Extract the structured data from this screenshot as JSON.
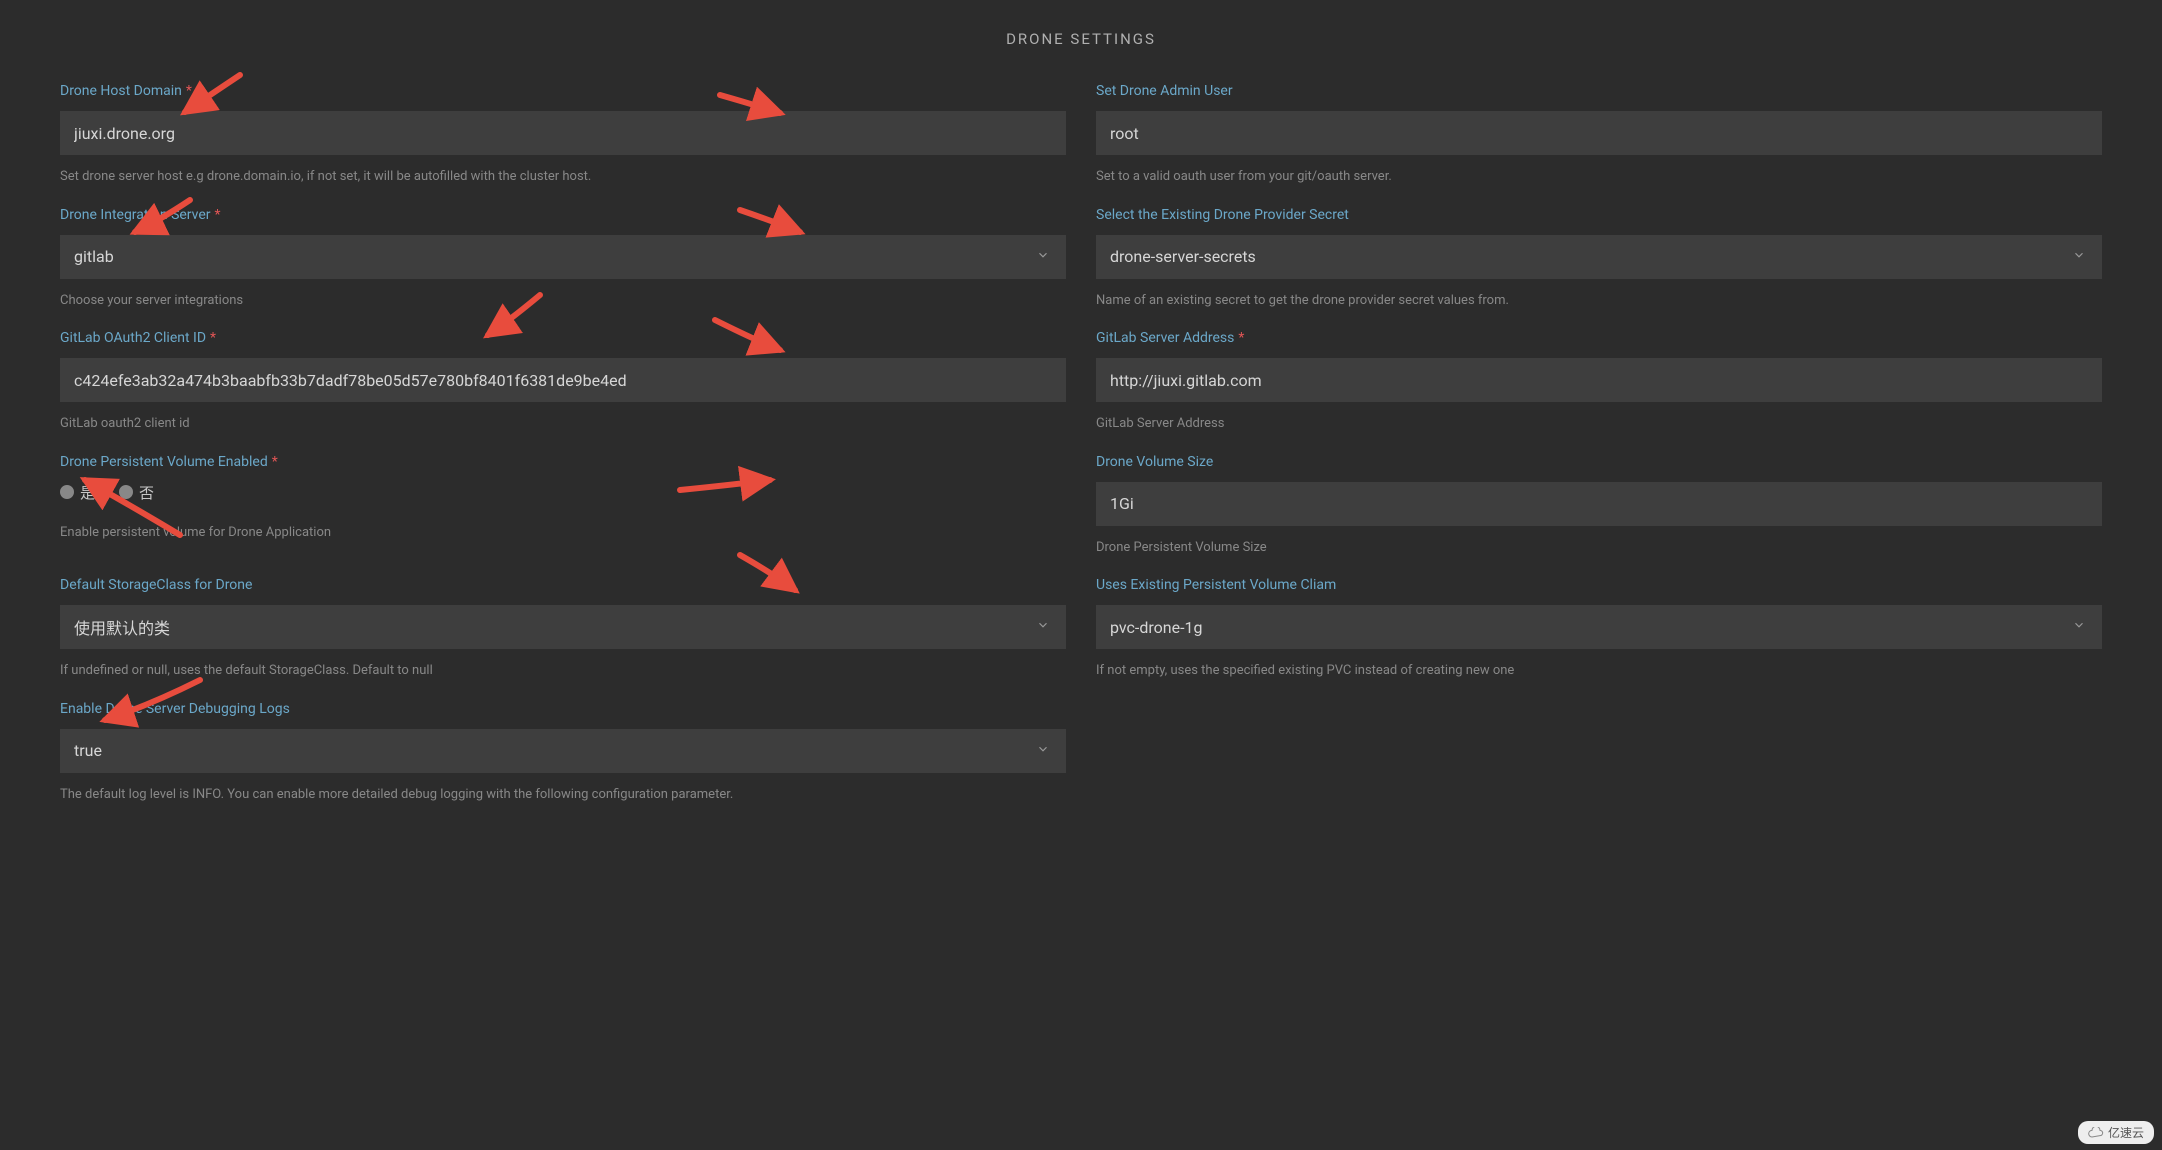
{
  "section": {
    "title": "DRONE SETTINGS"
  },
  "fields": {
    "hostDomain": {
      "label": "Drone Host Domain",
      "value": "jiuxi.drone.org",
      "help": "Set drone server host e.g drone.domain.io, if not set, it will be autofilled with the cluster host."
    },
    "adminUser": {
      "label": "Set Drone Admin User",
      "value": "root",
      "help": "Set to a valid oauth user from your git/oauth server."
    },
    "integrationServer": {
      "label": "Drone Integration Server",
      "value": "gitlab",
      "help": "Choose your server integrations"
    },
    "providerSecret": {
      "label": "Select the Existing Drone Provider Secret",
      "value": "drone-server-secrets",
      "help": "Name of an existing secret to get the drone provider secret values from."
    },
    "oauthClientId": {
      "label": "GitLab OAuth2 Client ID",
      "value": "c424efe3ab32a474b3baabfb33b7dadf78be05d57e780bf8401f6381de9be4ed",
      "help": "GitLab oauth2 client id"
    },
    "serverAddress": {
      "label": "GitLab Server Address",
      "value": "http://jiuxi.gitlab.com",
      "help": "GitLab Server Address"
    },
    "pvEnabled": {
      "label": "Drone Persistent Volume Enabled",
      "yes": "是",
      "no": "否",
      "help": "Enable persistent volume for Drone Application"
    },
    "volumeSize": {
      "label": "Drone Volume Size",
      "value": "1Gi",
      "help": "Drone Persistent Volume Size"
    },
    "storageClass": {
      "label": "Default StorageClass for Drone",
      "value": "使用默认的类",
      "help": "If undefined or null, uses the default StorageClass. Default to null"
    },
    "pvc": {
      "label": "Uses Existing Persistent Volume Cliam",
      "value": "pvc-drone-1g",
      "help": "If not empty, uses the specified existing PVC instead of creating new one"
    },
    "debugLogs": {
      "label": "Enable Drone Server Debugging Logs",
      "value": "true",
      "help": "The default log level is INFO. You can enable more detailed debug logging with the following configuration parameter."
    }
  },
  "watermark": {
    "text": "亿速云"
  }
}
